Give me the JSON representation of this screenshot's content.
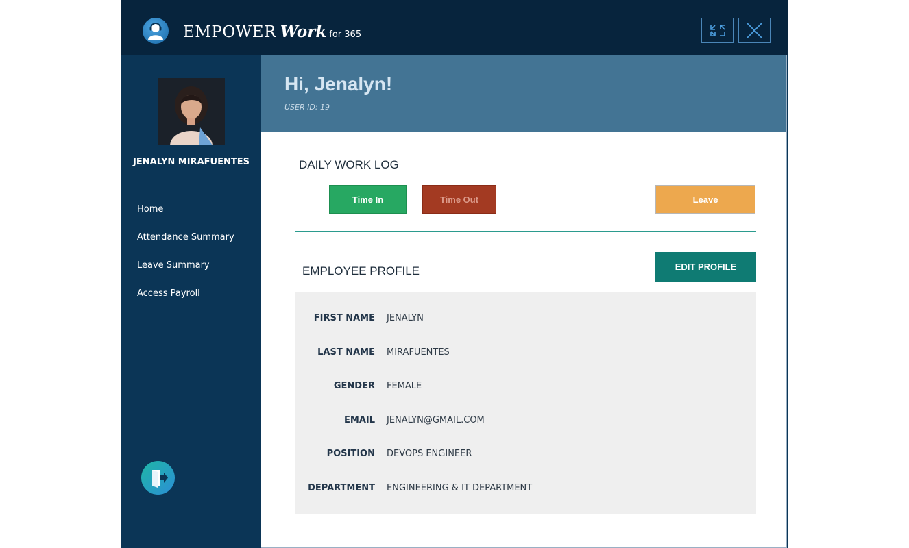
{
  "window": {
    "app_name_brand": "EMPOWER",
    "app_name_work": "Work",
    "app_name_suffix": "for 365"
  },
  "sidebar": {
    "username": "JENALYN MIRAFUENTES",
    "items": [
      {
        "label": "Home"
      },
      {
        "label": "Attendance Summary"
      },
      {
        "label": "Leave Summary"
      },
      {
        "label": "Access Payroll"
      }
    ]
  },
  "header": {
    "greeting": "Hi,  Jenalyn!",
    "user_id": "USER ID:  19"
  },
  "work_log": {
    "title": "DAILY WORK LOG",
    "time_in_label": "Time In",
    "time_out_label": "Time Out",
    "leave_label": "Leave"
  },
  "profile": {
    "title": "EMPLOYEE PROFILE",
    "edit_label": "EDIT PROFILE",
    "fields": [
      {
        "label": "FIRST NAME",
        "value": "JENALYN"
      },
      {
        "label": "LAST NAME",
        "value": "MIRAFUENTES"
      },
      {
        "label": "GENDER",
        "value": "FEMALE"
      },
      {
        "label": "EMAIL",
        "value": "JENALYN@GMAIL.COM"
      },
      {
        "label": "POSITION",
        "value": "DEVOPS ENGINEER"
      },
      {
        "label": "DEPARTMENT",
        "value": "ENGINEERING & IT DEPARTMENT"
      }
    ]
  },
  "colors": {
    "sidebar_bg": "#0b3556",
    "titlebar_bg": "#07243d",
    "banner_bg": "#437494",
    "time_in": "#27a862",
    "time_out": "#a33a22",
    "leave": "#eda84e",
    "edit_profile": "#0f7b73"
  },
  "icons": {
    "app_logo": "user-headset-icon",
    "restore": "restore-icon",
    "close": "close-icon",
    "logout": "logout-door-icon"
  }
}
